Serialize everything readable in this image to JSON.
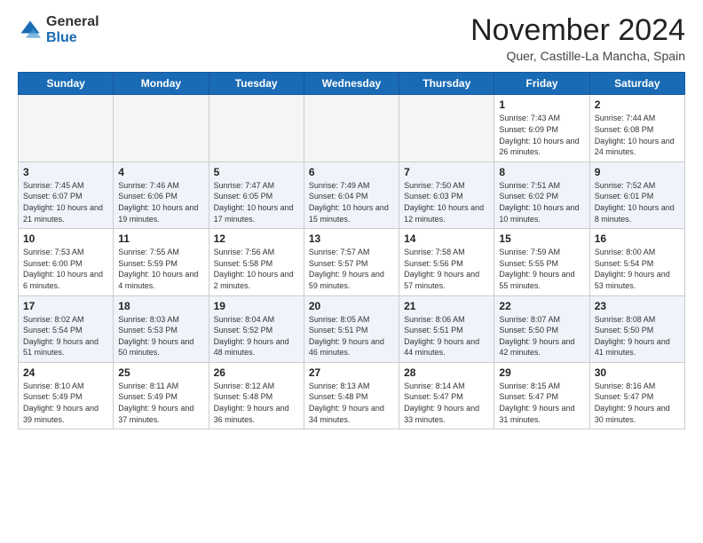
{
  "header": {
    "logo_general": "General",
    "logo_blue": "Blue",
    "month_title": "November 2024",
    "location": "Quer, Castille-La Mancha, Spain"
  },
  "weekdays": [
    "Sunday",
    "Monday",
    "Tuesday",
    "Wednesday",
    "Thursday",
    "Friday",
    "Saturday"
  ],
  "weeks": [
    [
      {
        "day": "",
        "info": ""
      },
      {
        "day": "",
        "info": ""
      },
      {
        "day": "",
        "info": ""
      },
      {
        "day": "",
        "info": ""
      },
      {
        "day": "",
        "info": ""
      },
      {
        "day": "1",
        "info": "Sunrise: 7:43 AM\nSunset: 6:09 PM\nDaylight: 10 hours and 26 minutes."
      },
      {
        "day": "2",
        "info": "Sunrise: 7:44 AM\nSunset: 6:08 PM\nDaylight: 10 hours and 24 minutes."
      }
    ],
    [
      {
        "day": "3",
        "info": "Sunrise: 7:45 AM\nSunset: 6:07 PM\nDaylight: 10 hours and 21 minutes."
      },
      {
        "day": "4",
        "info": "Sunrise: 7:46 AM\nSunset: 6:06 PM\nDaylight: 10 hours and 19 minutes."
      },
      {
        "day": "5",
        "info": "Sunrise: 7:47 AM\nSunset: 6:05 PM\nDaylight: 10 hours and 17 minutes."
      },
      {
        "day": "6",
        "info": "Sunrise: 7:49 AM\nSunset: 6:04 PM\nDaylight: 10 hours and 15 minutes."
      },
      {
        "day": "7",
        "info": "Sunrise: 7:50 AM\nSunset: 6:03 PM\nDaylight: 10 hours and 12 minutes."
      },
      {
        "day": "8",
        "info": "Sunrise: 7:51 AM\nSunset: 6:02 PM\nDaylight: 10 hours and 10 minutes."
      },
      {
        "day": "9",
        "info": "Sunrise: 7:52 AM\nSunset: 6:01 PM\nDaylight: 10 hours and 8 minutes."
      }
    ],
    [
      {
        "day": "10",
        "info": "Sunrise: 7:53 AM\nSunset: 6:00 PM\nDaylight: 10 hours and 6 minutes."
      },
      {
        "day": "11",
        "info": "Sunrise: 7:55 AM\nSunset: 5:59 PM\nDaylight: 10 hours and 4 minutes."
      },
      {
        "day": "12",
        "info": "Sunrise: 7:56 AM\nSunset: 5:58 PM\nDaylight: 10 hours and 2 minutes."
      },
      {
        "day": "13",
        "info": "Sunrise: 7:57 AM\nSunset: 5:57 PM\nDaylight: 9 hours and 59 minutes."
      },
      {
        "day": "14",
        "info": "Sunrise: 7:58 AM\nSunset: 5:56 PM\nDaylight: 9 hours and 57 minutes."
      },
      {
        "day": "15",
        "info": "Sunrise: 7:59 AM\nSunset: 5:55 PM\nDaylight: 9 hours and 55 minutes."
      },
      {
        "day": "16",
        "info": "Sunrise: 8:00 AM\nSunset: 5:54 PM\nDaylight: 9 hours and 53 minutes."
      }
    ],
    [
      {
        "day": "17",
        "info": "Sunrise: 8:02 AM\nSunset: 5:54 PM\nDaylight: 9 hours and 51 minutes."
      },
      {
        "day": "18",
        "info": "Sunrise: 8:03 AM\nSunset: 5:53 PM\nDaylight: 9 hours and 50 minutes."
      },
      {
        "day": "19",
        "info": "Sunrise: 8:04 AM\nSunset: 5:52 PM\nDaylight: 9 hours and 48 minutes."
      },
      {
        "day": "20",
        "info": "Sunrise: 8:05 AM\nSunset: 5:51 PM\nDaylight: 9 hours and 46 minutes."
      },
      {
        "day": "21",
        "info": "Sunrise: 8:06 AM\nSunset: 5:51 PM\nDaylight: 9 hours and 44 minutes."
      },
      {
        "day": "22",
        "info": "Sunrise: 8:07 AM\nSunset: 5:50 PM\nDaylight: 9 hours and 42 minutes."
      },
      {
        "day": "23",
        "info": "Sunrise: 8:08 AM\nSunset: 5:50 PM\nDaylight: 9 hours and 41 minutes."
      }
    ],
    [
      {
        "day": "24",
        "info": "Sunrise: 8:10 AM\nSunset: 5:49 PM\nDaylight: 9 hours and 39 minutes."
      },
      {
        "day": "25",
        "info": "Sunrise: 8:11 AM\nSunset: 5:49 PM\nDaylight: 9 hours and 37 minutes."
      },
      {
        "day": "26",
        "info": "Sunrise: 8:12 AM\nSunset: 5:48 PM\nDaylight: 9 hours and 36 minutes."
      },
      {
        "day": "27",
        "info": "Sunrise: 8:13 AM\nSunset: 5:48 PM\nDaylight: 9 hours and 34 minutes."
      },
      {
        "day": "28",
        "info": "Sunrise: 8:14 AM\nSunset: 5:47 PM\nDaylight: 9 hours and 33 minutes."
      },
      {
        "day": "29",
        "info": "Sunrise: 8:15 AM\nSunset: 5:47 PM\nDaylight: 9 hours and 31 minutes."
      },
      {
        "day": "30",
        "info": "Sunrise: 8:16 AM\nSunset: 5:47 PM\nDaylight: 9 hours and 30 minutes."
      }
    ]
  ]
}
